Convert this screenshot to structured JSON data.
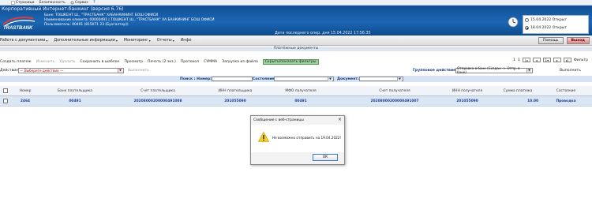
{
  "ie_bar": {
    "items": [
      "Страница",
      "Безопасность",
      "Сервис"
    ]
  },
  "banner": {
    "app_title": "Корпоративный Интернет-банкинг (версия 6.76)",
    "bank": "Банк: ТОШКЕНТ Ш., \"ТРАСТБАНК\" ХАБАНКИНИНГ БОШ ОФИСИ",
    "client": "Наименование клиента: 00000491 | ТОШКЕНТ Ш., \"ТРАСТБАНК\" ХА БАНКИНИНГ БОШ ОФИСИ",
    "user": "Пользователь: 00491 (815071 23 (Бухгалтер))",
    "ops_date": "Дата последнего опер. дня 15.04.2022 17:56:35",
    "logo_text": "TRASTBANK",
    "radio": [
      {
        "label": "15.04.2022  Открыт",
        "checked": false
      },
      {
        "label": "18.04.2022  Открыт",
        "checked": true
      }
    ]
  },
  "menu": {
    "items": [
      {
        "label": "Работа с документами",
        "caret": true
      },
      {
        "label": "Дополнительные информации",
        "caret": true
      },
      {
        "label": "Мониторинг",
        "caret": true
      },
      {
        "label": "Отчеты",
        "caret": true
      },
      {
        "label": "Инфо",
        "caret": false
      }
    ],
    "help": "Помощь",
    "exit": "Выход"
  },
  "section_title": "Платёжные документы",
  "toolbar": {
    "items": [
      {
        "label": "Создать платеж",
        "disabled": false,
        "highlight": false
      },
      {
        "label": "Изменить",
        "disabled": true,
        "highlight": false
      },
      {
        "label": "Удалить",
        "disabled": true,
        "highlight": false
      },
      {
        "label": "Сохранить в шаблон",
        "disabled": false,
        "highlight": false
      },
      {
        "label": "Просмотр",
        "disabled": false,
        "highlight": false
      },
      {
        "label": "Печать (2 экз.)",
        "disabled": false,
        "highlight": false
      },
      {
        "label": "Протокол",
        "disabled": false,
        "highlight": false
      },
      {
        "label": "СУММА",
        "disabled": false,
        "highlight": false
      },
      {
        "label": "Загрузка из файла",
        "disabled": false,
        "highlight": false
      },
      {
        "label": "Скрыть/показать фильтры",
        "disabled": false,
        "highlight": true
      }
    ],
    "page_current": "1",
    "page_total": "1",
    "filter_label": "Фильтр"
  },
  "actions": {
    "label": "Действие:",
    "select_value": "--- Выберите действие ---",
    "execute": "Выполнить",
    "group_label": "Групповое действие:",
    "group_value": "Отправка в банк (Создан -> Отпр. в банк)",
    "group_execute": "Выполнить"
  },
  "filter": {
    "search_label": "Поиск : Номер:",
    "state_label": "Состояние:",
    "document_label": "Документ:"
  },
  "table": {
    "headers": [
      "Номер",
      "Банк плательщика",
      "Счет плательщика",
      "ИНН плательщика",
      "МФО получателя",
      "Счет получателя",
      "ИНН получателя",
      "Сумма платежа",
      "Состояние"
    ],
    "rows": [
      [
        "2464",
        "00491",
        "20208000200000491008",
        "201055090",
        "00491",
        "20208000200000491007",
        "201055090",
        "10.00",
        "Проводка"
      ]
    ]
  },
  "dialog": {
    "title": "Сообщение с веб-страницы",
    "message": "Не возможно отправить на 19.04.2022!",
    "ok": "ОК"
  }
}
